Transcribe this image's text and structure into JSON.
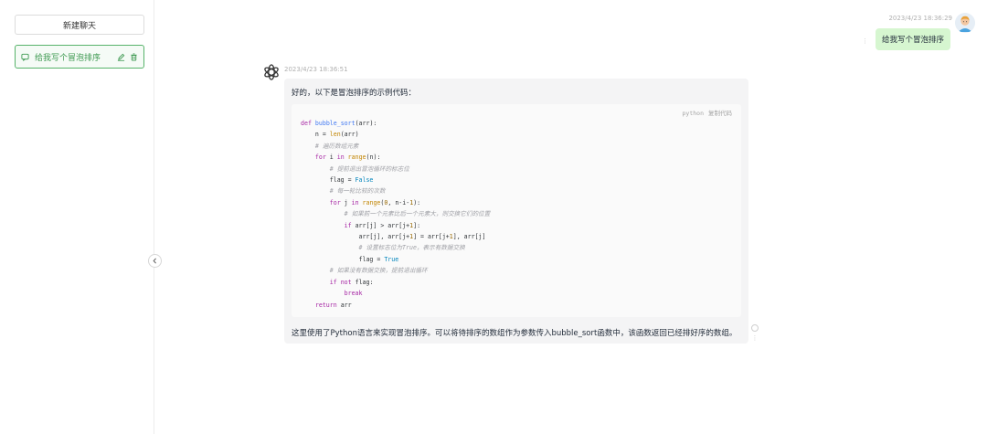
{
  "sidebar": {
    "new_chat_label": "新建聊天",
    "chat_items": [
      {
        "label": "给我写个冒泡排序"
      }
    ],
    "accent": "#57b36a"
  },
  "conversation": {
    "user_message": {
      "timestamp": "2023/4/23 18:36:29",
      "text": "给我写个冒泡排序",
      "bubble_color": "#d6f6d0"
    },
    "assistant_message": {
      "timestamp": "2023/4/23 18:36:51",
      "intro": "好的，以下是冒泡排序的示例代码：",
      "code_language": "python",
      "copy_label": "复制代码",
      "code_lines": [
        "def bubble_sort(arr):",
        "    n = len(arr)",
        "    # 遍历数组元素",
        "    for i in range(n):",
        "        # 提前退出冒泡循环的标志位",
        "        flag = False",
        "        # 每一轮比较的次数",
        "        for j in range(0, n-i-1):",
        "            # 如果前一个元素比后一个元素大，则交换它们的位置",
        "            if arr[j] > arr[j+1]:",
        "                arr[j], arr[j+1] = arr[j+1], arr[j]",
        "                # 设置标志位为True，表示有数据交换",
        "                flag = True",
        "        # 如果没有数据交换，提前退出循环",
        "        if not flag:",
        "            break",
        "    return arr"
      ],
      "summary": "这里使用了Python语言来实现冒泡排序。可以将待排序的数组作为参数传入bubble_sort函数中，该函数返回已经排好序的数组。"
    }
  }
}
